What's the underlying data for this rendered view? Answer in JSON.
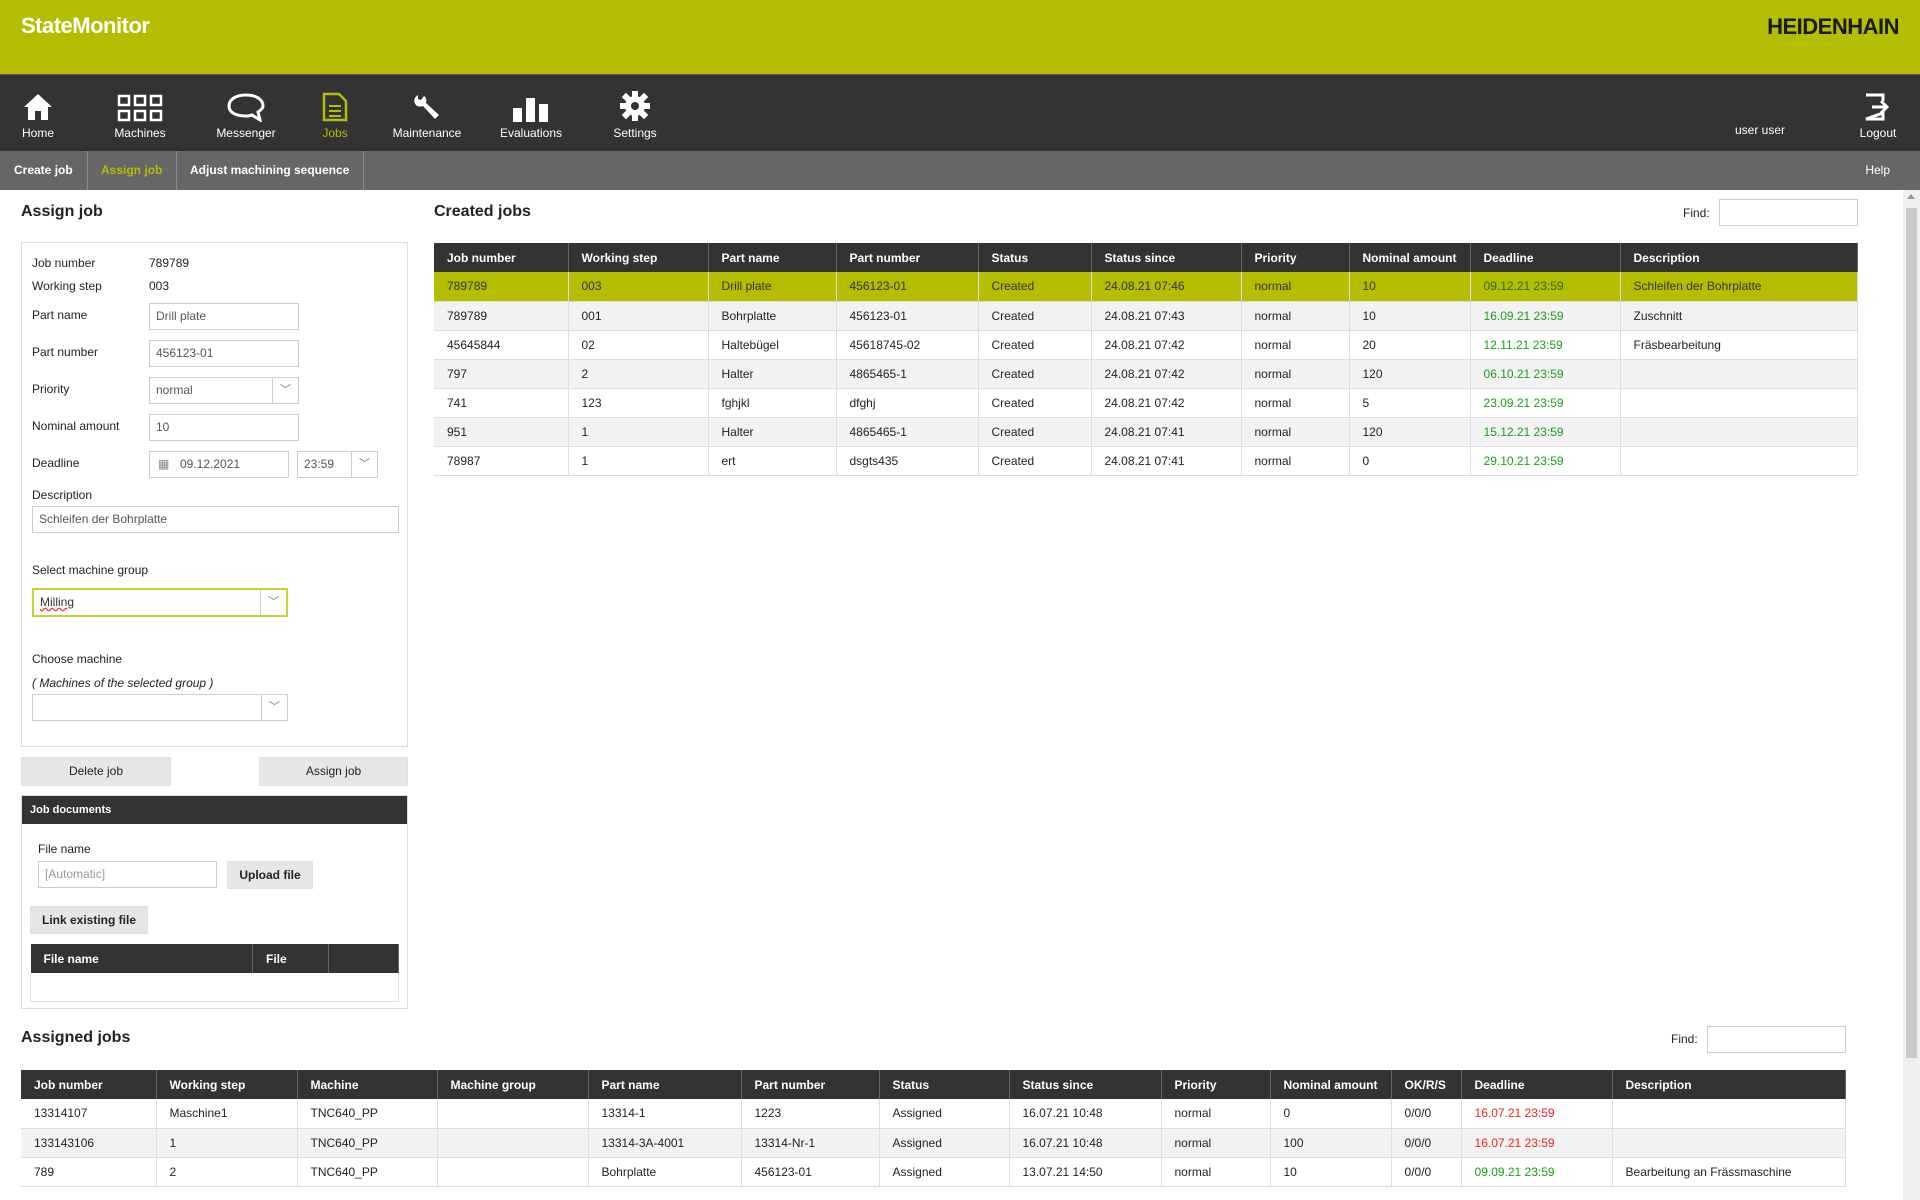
{
  "app": {
    "title": "StateMonitor",
    "logo": "HEIDENHAIN",
    "accent": "#b5bd00"
  },
  "nav": {
    "items": [
      {
        "label": "Home",
        "icon": "home-icon"
      },
      {
        "label": "Machines",
        "icon": "grid-icon"
      },
      {
        "label": "Messenger",
        "icon": "chat-bubble-icon"
      },
      {
        "label": "Jobs",
        "icon": "document-icon"
      },
      {
        "label": "Maintenance",
        "icon": "wrench-icon"
      },
      {
        "label": "Evaluations",
        "icon": "bar-chart-icon"
      },
      {
        "label": "Settings",
        "icon": "gear-icon"
      }
    ],
    "user": "user user",
    "logout": "Logout"
  },
  "subnav": {
    "items": [
      "Create job",
      "Assign job",
      "Adjust machining sequence"
    ],
    "help": "Help"
  },
  "assign": {
    "title": "Assign job",
    "job_number_label": "Job number",
    "job_number": "789789",
    "working_step_label": "Working step",
    "working_step": "003",
    "part_name_label": "Part name",
    "part_name": "Drill plate",
    "part_number_label": "Part number",
    "part_number": "456123-01",
    "priority_label": "Priority",
    "priority": "normal",
    "nominal_label": "Nominal amount",
    "nominal": "10",
    "deadline_label": "Deadline",
    "deadline_date": "09.12.2021",
    "deadline_time": "23:59",
    "description_label": "Description",
    "description": "Schleifen der Bohrplatte",
    "group_label": "Select machine group",
    "group": "Milling",
    "machine_label": "Choose machine",
    "machine_hint": "( Machines of the selected group )",
    "machine": "",
    "delete_btn": "Delete job",
    "assign_btn": "Assign job"
  },
  "docs": {
    "title": "Job documents",
    "file_label": "File name",
    "file_placeholder": "[Automatic]",
    "upload_btn": "Upload file",
    "link_btn": "Link existing file",
    "columns": [
      "File name",
      "File",
      ""
    ]
  },
  "created": {
    "title": "Created jobs",
    "find_label": "Find:",
    "columns": [
      "Job number",
      "Working step",
      "Part name",
      "Part number",
      "Status",
      "Status since",
      "Priority",
      "Nominal amount",
      "Deadline",
      "Description"
    ],
    "rows": [
      [
        "789789",
        "003",
        "Drill plate",
        "456123-01",
        "Created",
        "24.08.21 07:46",
        "normal",
        "10",
        "09.12.21 23:59",
        "Schleifen der Bohrplatte"
      ],
      [
        "789789",
        "001",
        "Bohrplatte",
        "456123-01",
        "Created",
        "24.08.21 07:43",
        "normal",
        "10",
        "16.09.21 23:59",
        "Zuschnitt"
      ],
      [
        "45645844",
        "02",
        "Haltebügel",
        "45618745-02",
        "Created",
        "24.08.21 07:42",
        "normal",
        "20",
        "12.11.21 23:59",
        "Fräsbearbeitung"
      ],
      [
        "797",
        "2",
        "Halter",
        "4865465-1",
        "Created",
        "24.08.21 07:42",
        "normal",
        "120",
        "06.10.21 23:59",
        ""
      ],
      [
        "741",
        "123",
        "fghjkl",
        "dfghj",
        "Created",
        "24.08.21 07:42",
        "normal",
        "5",
        "23.09.21 23:59",
        ""
      ],
      [
        "951",
        "1",
        "Halter",
        "4865465-1",
        "Created",
        "24.08.21 07:41",
        "normal",
        "120",
        "15.12.21 23:59",
        ""
      ],
      [
        "78987",
        "1",
        "ert",
        "dsgts435",
        "Created",
        "24.08.21 07:41",
        "normal",
        "0",
        "29.10.21 23:59",
        ""
      ]
    ]
  },
  "assigned": {
    "title": "Assigned jobs",
    "find_label": "Find:",
    "columns": [
      "Job number",
      "Working step",
      "Machine",
      "Machine group",
      "Part name",
      "Part number",
      "Status",
      "Status since",
      "Priority",
      "Nominal amount",
      "OK/R/S",
      "Deadline",
      "Description"
    ],
    "rows": [
      [
        "13314107",
        "Maschine1",
        "TNC640_PP",
        "",
        "13314-1",
        "1223",
        "Assigned",
        "16.07.21 10:48",
        "normal",
        "0",
        "0/0/0",
        "16.07.21 23:59",
        ""
      ],
      [
        "133143106",
        "1",
        "TNC640_PP",
        "",
        "13314-3A-4001",
        "13314-Nr-1",
        "Assigned",
        "16.07.21 10:48",
        "normal",
        "100",
        "0/0/0",
        "16.07.21 23:59",
        ""
      ],
      [
        "789",
        "2",
        "TNC640_PP",
        "",
        "Bohrplatte",
        "456123-01",
        "Assigned",
        "13.07.21 14:50",
        "normal",
        "10",
        "0/0/0",
        "09.09.21 23:59",
        "Bearbeitung an Frässmaschine"
      ]
    ],
    "deadline_colors": [
      "red",
      "red",
      "green"
    ]
  }
}
